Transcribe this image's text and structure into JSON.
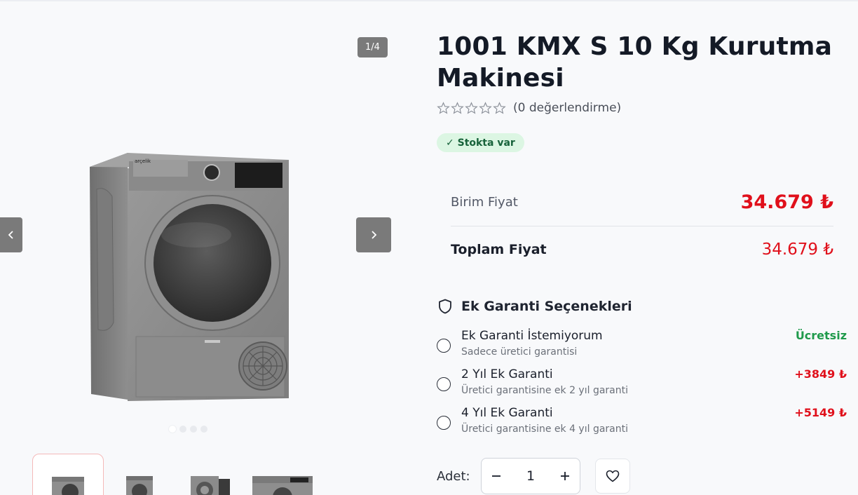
{
  "product": {
    "title": "1001 KMX S 10 Kg Kurutma Makinesi",
    "rating_text": "(0 değerlendirme)",
    "rating": 0,
    "stars_total": 5,
    "stock": "✓ Stokta var"
  },
  "gallery": {
    "counter": "1/4",
    "current_image": 1,
    "total_images": 4,
    "prev_icon": "chevron-left-icon",
    "next_icon": "chevron-right-icon",
    "brand_on_image": "arçelik"
  },
  "pricing": {
    "unit_label": "Birim Fiyat",
    "unit_price": "34.679 ₺",
    "total_label": "Toplam Fiyat",
    "total_price": "34.679 ₺"
  },
  "warranty": {
    "title": "Ek Garanti Seçenekleri",
    "options": [
      {
        "name": "Ek Garanti İstemiyorum",
        "desc": "Sadece üretici garantisi",
        "price": "Ücretsiz"
      },
      {
        "name": "2 Yıl Ek Garanti",
        "desc": "Üretici garantisine ek 2 yıl garanti",
        "price": "+3849 ₺"
      },
      {
        "name": "4 Yıl Ek Garanti",
        "desc": "Üretici garantisine ek 4 yıl garanti",
        "price": "+5149 ₺"
      }
    ]
  },
  "quantity": {
    "label": "Adet:",
    "value": "1",
    "minus": "−",
    "plus": "+"
  },
  "colors": {
    "price_red": "#e0101b",
    "free_green": "#1f9a4b",
    "stock_bg": "#dcf6e3"
  }
}
